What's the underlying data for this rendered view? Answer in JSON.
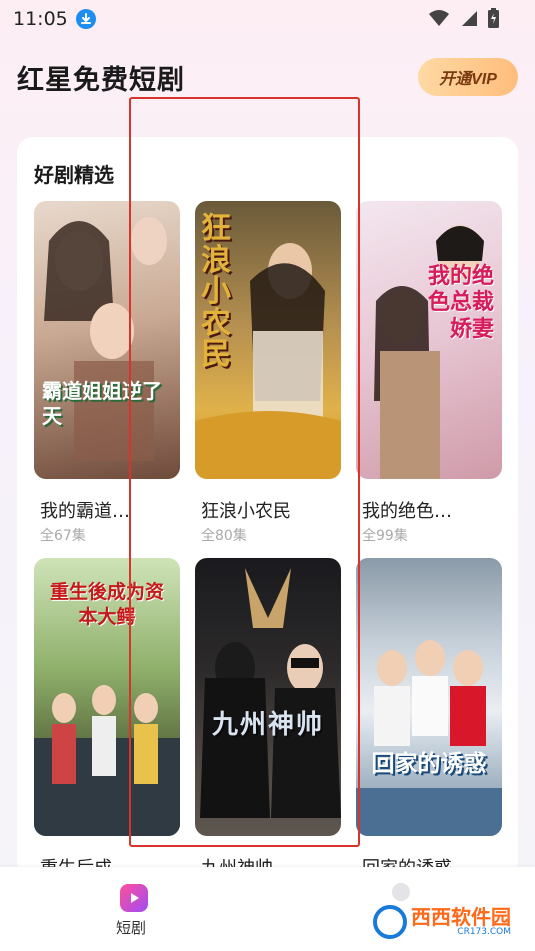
{
  "status_bar": {
    "time": "11:05"
  },
  "header": {
    "title": "红星免费短剧",
    "vip_button": "开通VIP"
  },
  "section": {
    "title": "好剧精选"
  },
  "dramas": [
    {
      "title": "我的霸道…",
      "count": "全67集",
      "poster_text": "霸道姐姐逆了天"
    },
    {
      "title": "狂浪小农民",
      "count": "全80集",
      "poster_text": "狂浪小农民"
    },
    {
      "title": "我的绝色…",
      "count": "全99集",
      "poster_text": "我的绝色总裁娇妻"
    },
    {
      "title": "重生后成…",
      "count": "",
      "poster_text": "重生後成为资本大鳄"
    },
    {
      "title": "九州神帅",
      "count": "",
      "poster_text": "九州神帅"
    },
    {
      "title": "回家的诱惑",
      "count": "",
      "poster_text": "回家的诱惑"
    }
  ],
  "bottom_nav": {
    "tab_label": "短剧"
  },
  "watermark": {
    "brand": "西西软件园",
    "domain": "CR173.COM"
  },
  "colors": {
    "accent": "#ff4f9a",
    "vip": "#ffbd7c",
    "highlight_box": "#d9342b"
  },
  "icons": [
    "download-icon",
    "wifi-icon",
    "signal-icon",
    "battery-icon",
    "drama-tab-icon",
    "profile-icon"
  ]
}
